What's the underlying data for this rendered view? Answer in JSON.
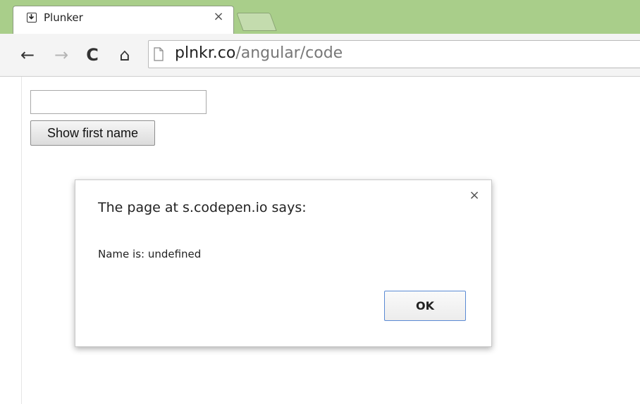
{
  "browser": {
    "tab_title": "Plunker",
    "tab_close_icon": "×",
    "url_host": "plnkr.co",
    "url_path": "/angular/code",
    "back_icon": "←",
    "forward_icon": "→",
    "reload_icon": "C",
    "home_icon": "⌂",
    "colors": {
      "tabstrip": "#a9ce8a"
    }
  },
  "page": {
    "name_input": {
      "value": "",
      "placeholder": ""
    },
    "show_button_label": "Show first name"
  },
  "dialog": {
    "title": "The page at s.codepen.io says:",
    "message": "Name is: undefined",
    "ok_label": "OK",
    "close_icon": "×",
    "colors": {
      "ok_border": "#5a8ad4"
    }
  }
}
